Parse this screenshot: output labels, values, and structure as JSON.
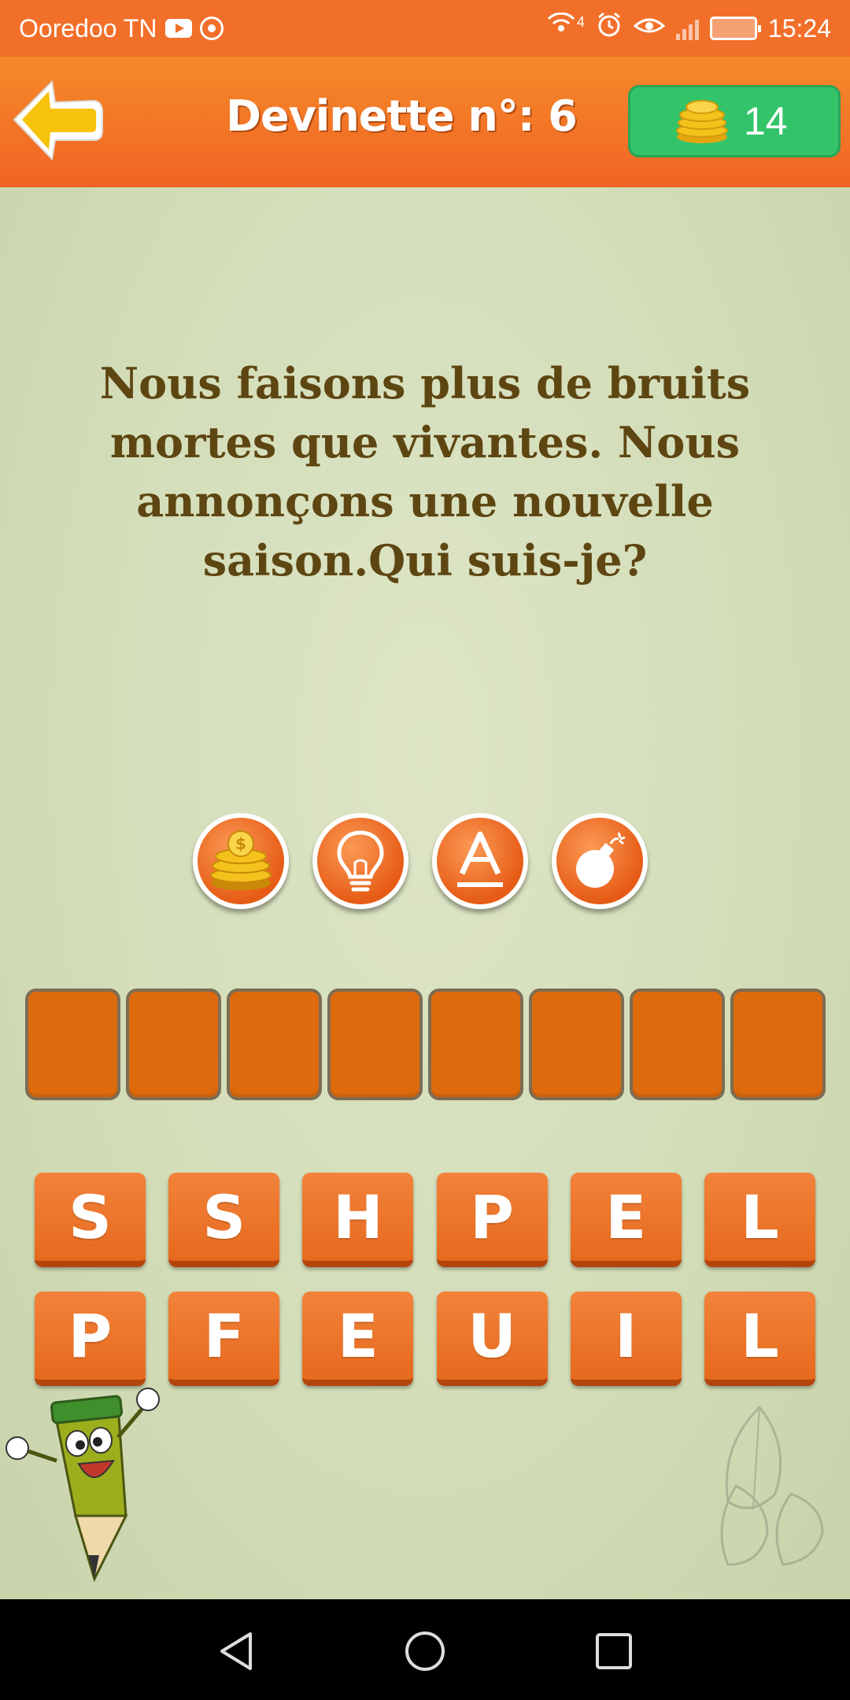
{
  "status_bar": {
    "carrier": "Ooredoo TN",
    "time": "15:24",
    "network_badge": "4"
  },
  "header": {
    "title": "Devinette n°: 6",
    "coins": "14"
  },
  "riddle": {
    "lines": [
      "Nous faisons plus de bruits",
      "mortes que vivantes. Nous",
      "annonçons une nouvelle",
      "saison.Qui suis-je?"
    ]
  },
  "powerups": [
    {
      "icon": "coins-icon"
    },
    {
      "icon": "lightbulb-icon"
    },
    {
      "icon": "letter-a-icon"
    },
    {
      "icon": "bomb-icon"
    }
  ],
  "answer_slots": [
    "",
    "",
    "",
    "",
    "",
    "",
    "",
    ""
  ],
  "letters_row1": [
    "S",
    "S",
    "H",
    "P",
    "E",
    "L"
  ],
  "letters_row2": [
    "P",
    "F",
    "E",
    "U",
    "I",
    "L"
  ],
  "colors": {
    "status_bar": "#f26f2a",
    "header": "#f26424",
    "coin_box": "#33c46a",
    "riddle_text": "#5e4612",
    "slot": "#dd6a0c",
    "key": "#e66a1e"
  }
}
